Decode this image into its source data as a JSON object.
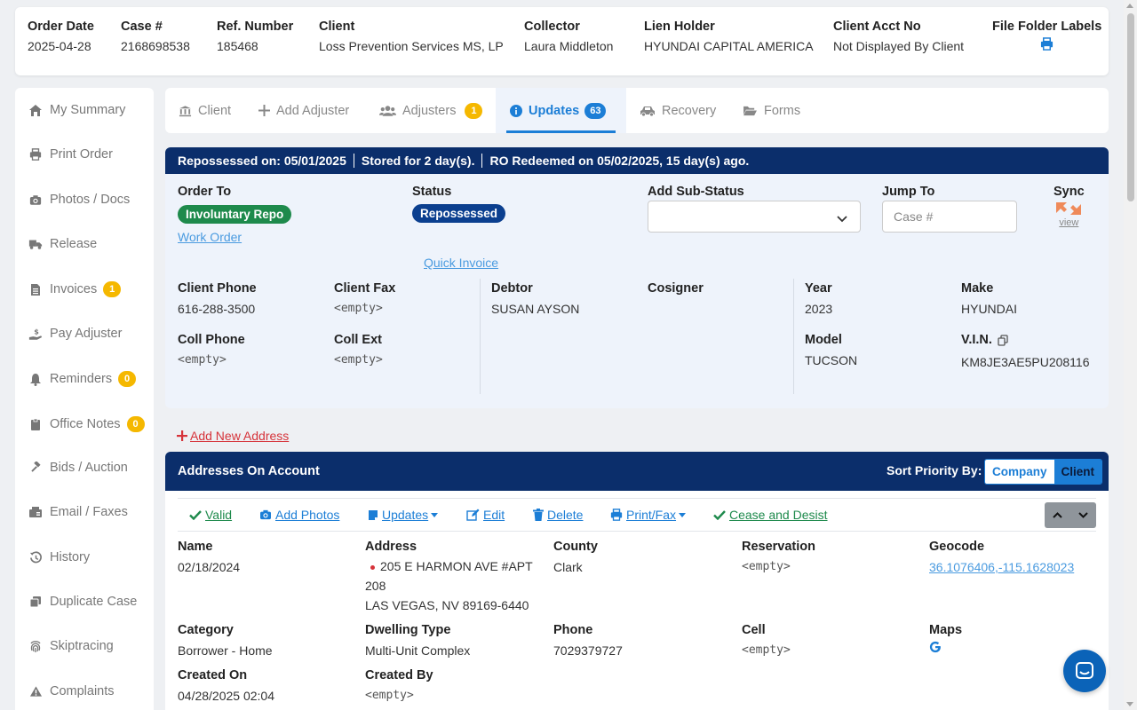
{
  "header": {
    "fields": [
      {
        "label": "Order Date",
        "value": "2025-04-28"
      },
      {
        "label": "Case #",
        "value": "2168698538"
      },
      {
        "label": "Ref. Number",
        "value": "185468"
      },
      {
        "label": "Client",
        "value": "Loss Prevention Services MS, LP"
      },
      {
        "label": "Collector",
        "value": "Laura Middleton"
      },
      {
        "label": "Lien Holder",
        "value": "HYUNDAI CAPITAL AMERICA"
      },
      {
        "label": "Client Acct No",
        "value": "Not Displayed By Client"
      }
    ],
    "file_folder_label": "File Folder Labels",
    "print_icon": "print-icon"
  },
  "sidebar": {
    "items": [
      {
        "label": "My Summary",
        "icon": "home-icon"
      },
      {
        "label": "Print Order",
        "icon": "print-icon"
      },
      {
        "label": "Photos / Docs",
        "icon": "camera-icon"
      },
      {
        "label": "Release",
        "icon": "truck-icon"
      },
      {
        "label": "Invoices",
        "icon": "invoice-icon",
        "badge": "1"
      },
      {
        "label": "Pay Adjuster",
        "icon": "hand-dollar-icon"
      },
      {
        "label": "Reminders",
        "icon": "bell-icon",
        "badge": "0"
      },
      {
        "label": "Office Notes",
        "icon": "clipboard-icon",
        "badge": "0"
      },
      {
        "label": "Bids / Auction",
        "icon": "gavel-icon"
      },
      {
        "label": "Email / Faxes",
        "icon": "fax-icon"
      },
      {
        "label": "History",
        "icon": "history-icon"
      },
      {
        "label": "Duplicate Case",
        "icon": "copy-icon"
      },
      {
        "label": "Skiptracing",
        "icon": "fingerprint-icon"
      },
      {
        "label": "Complaints",
        "icon": "warning-icon"
      }
    ]
  },
  "tabs": [
    {
      "label": "Client",
      "icon": "bank-icon"
    },
    {
      "label": "Add Adjuster",
      "icon": "plus-icon"
    },
    {
      "label": "Adjusters",
      "icon": "users-icon",
      "badge": "1"
    },
    {
      "label": "Updates",
      "icon": "info-icon",
      "badge": "63",
      "active": true
    },
    {
      "label": "Recovery",
      "icon": "car-icon"
    },
    {
      "label": "Forms",
      "icon": "folder-open-icon"
    }
  ],
  "repo": {
    "bar": {
      "repossessed": "Repossessed on: 05/01/2025",
      "stored": "Stored for 2 day(s).",
      "redeemed": "RO Redeemed on 05/02/2025, 15 day(s) ago."
    },
    "order_to": {
      "label": "Order To",
      "pill": "Involuntary Repo",
      "pill_color": "#1e8a4c",
      "work_order": "Work Order"
    },
    "status": {
      "label": "Status",
      "pill": "Repossessed",
      "pill_color": "#0b3f8f",
      "quick_invoice": "Quick Invoice"
    },
    "sub_status": {
      "label": "Add Sub-Status",
      "value": ""
    },
    "jump_to": {
      "label": "Jump To",
      "placeholder": "Case #"
    },
    "sync": {
      "label": "Sync",
      "view": "view"
    },
    "client_phone": {
      "label": "Client Phone",
      "value": "616-288-3500"
    },
    "client_fax": {
      "label": "Client Fax",
      "value": "<empty>"
    },
    "coll_phone": {
      "label": "Coll Phone",
      "value": "<empty>"
    },
    "coll_ext": {
      "label": "Coll Ext",
      "value": "<empty>"
    },
    "debtor": {
      "label": "Debtor",
      "value": "SUSAN AYSON"
    },
    "cosigner": {
      "label": "Cosigner",
      "value": ""
    },
    "year": {
      "label": "Year",
      "value": "2023"
    },
    "make": {
      "label": "Make",
      "value": "HYUNDAI"
    },
    "model": {
      "label": "Model",
      "value": "TUCSON"
    },
    "vin": {
      "label": "V.I.N.",
      "value": "KM8JE3AE5PU208116"
    }
  },
  "add_address": "Add New Address",
  "addresses": {
    "title": "Addresses On Account",
    "sort_label": "Sort Priority By:",
    "sort_options": [
      "Company",
      "Client"
    ],
    "actions": [
      {
        "label": "Valid",
        "icon": "check-icon",
        "color": "#1e8a4c"
      },
      {
        "label": "Add Photos",
        "icon": "camera-icon",
        "color": "#1c7ed6"
      },
      {
        "label": "Updates",
        "icon": "note-icon",
        "color": "#1c7ed6"
      },
      {
        "label": "Edit",
        "icon": "edit-icon",
        "color": "#1c7ed6"
      },
      {
        "label": "Delete",
        "icon": "trash-icon",
        "color": "#1c7ed6"
      },
      {
        "label": "Print/Fax",
        "icon": "print-icon",
        "color": "#1c7ed6"
      },
      {
        "label": "Cease and Desist",
        "icon": "check-icon",
        "color": "#1e8a4c"
      }
    ],
    "record": {
      "name": {
        "label": "Name",
        "value": "02/18/2024"
      },
      "address": {
        "label": "Address",
        "line1": "205 E HARMON AVE #APT",
        "line2": "208",
        "line3": "LAS VEGAS, NV 89169-6440"
      },
      "county": {
        "label": "County",
        "value": "Clark"
      },
      "reservation": {
        "label": "Reservation",
        "value": "<empty>"
      },
      "geocode": {
        "label": "Geocode",
        "value": "36.1076406,-115.1628023"
      },
      "category": {
        "label": "Category",
        "value": "Borrower - Home"
      },
      "dwelling": {
        "label": "Dwelling Type",
        "value": "Multi-Unit Complex"
      },
      "phone": {
        "label": "Phone",
        "value": "7029379727"
      },
      "cell": {
        "label": "Cell",
        "value": "<empty>"
      },
      "maps": {
        "label": "Maps",
        "icon": "google-icon"
      },
      "created_on": {
        "label": "Created On",
        "value": "04/28/2025 02:04"
      },
      "created_by": {
        "label": "Created By",
        "value": "<empty>"
      }
    }
  },
  "chat_icon": "chat-icon"
}
